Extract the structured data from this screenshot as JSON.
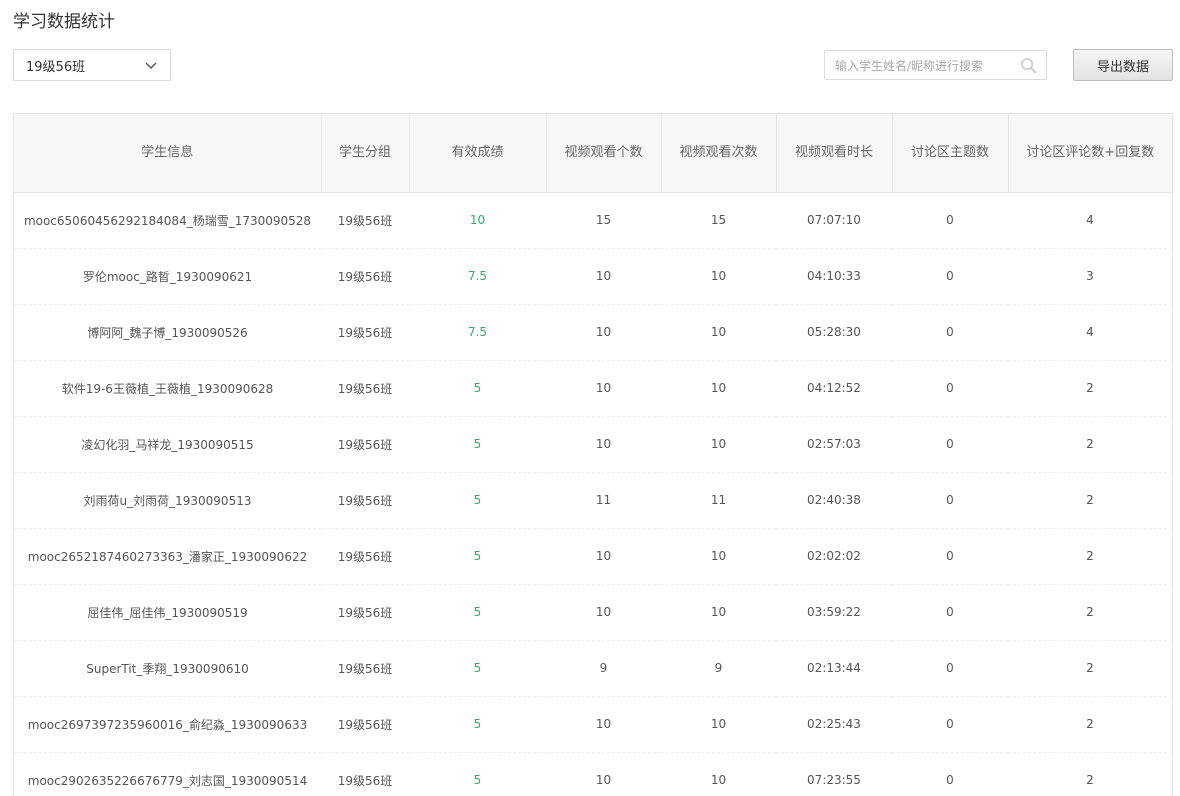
{
  "page": {
    "title": "学习数据统计"
  },
  "filter": {
    "class_selected": "19级56班"
  },
  "search": {
    "placeholder": "输入学生姓名/昵称进行搜索"
  },
  "toolbar": {
    "export_label": "导出数据"
  },
  "colors": {
    "score_green": "#1fb36b",
    "header_bg": "#f7f7f7"
  },
  "table": {
    "columns": [
      "学生信息",
      "学生分组",
      "有效成绩",
      "视频观看个数",
      "视频观看次数",
      "视频观看时长",
      "讨论区主题数",
      "讨论区评论数+回复数"
    ],
    "rows": [
      [
        "mooc65060456292184084_杨瑞雪_1730090528",
        "19级56班",
        "10",
        "15",
        "15",
        "07:07:10",
        "0",
        "4"
      ],
      [
        "罗伦mooc_路晢_1930090621",
        "19级56班",
        "7.5",
        "10",
        "10",
        "04:10:33",
        "0",
        "3"
      ],
      [
        "博阿阿_魏子博_1930090526",
        "19级56班",
        "7.5",
        "10",
        "10",
        "05:28:30",
        "0",
        "4"
      ],
      [
        "软件19-6王薇植_王薇植_1930090628",
        "19级56班",
        "5",
        "10",
        "10",
        "04:12:52",
        "0",
        "2"
      ],
      [
        "凌幻化羽_马祥龙_1930090515",
        "19级56班",
        "5",
        "10",
        "10",
        "02:57:03",
        "0",
        "2"
      ],
      [
        "刘雨荷u_刘雨荷_1930090513",
        "19级56班",
        "5",
        "11",
        "11",
        "02:40:38",
        "0",
        "2"
      ],
      [
        "mooc2652187460273363_潘家正_1930090622",
        "19级56班",
        "5",
        "10",
        "10",
        "02:02:02",
        "0",
        "2"
      ],
      [
        "屈佳伟_屈佳伟_1930090519",
        "19级56班",
        "5",
        "10",
        "10",
        "03:59:22",
        "0",
        "2"
      ],
      [
        "SuperTit_季翔_1930090610",
        "19级56班",
        "5",
        "9",
        "9",
        "02:13:44",
        "0",
        "2"
      ],
      [
        "mooc2697397235960016_俞纪淼_1930090633",
        "19级56班",
        "5",
        "10",
        "10",
        "02:25:43",
        "0",
        "2"
      ],
      [
        "mooc2902635226676779_刘志国_1930090514",
        "19级56班",
        "5",
        "10",
        "10",
        "07:23:55",
        "0",
        "2"
      ]
    ]
  }
}
